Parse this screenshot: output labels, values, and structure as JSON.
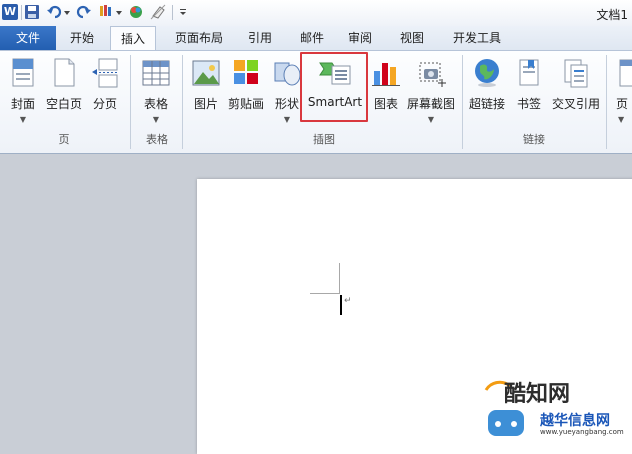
{
  "window": {
    "title": "文档1"
  },
  "qat": {
    "word_logo": "W",
    "icons": [
      "save-icon",
      "undo-icon",
      "redo-icon",
      "format-painter-icon",
      "color-icon",
      "eraser-icon",
      "customize-arrow-icon"
    ]
  },
  "tabs": [
    "文件",
    "开始",
    "插入",
    "页面布局",
    "引用",
    "邮件",
    "审阅",
    "视图",
    "开发工具"
  ],
  "active_tab": "插入",
  "ribbon": {
    "groups": {
      "page": "页",
      "table": "表格",
      "illustrations": "插图",
      "links": "链接"
    },
    "buttons": {
      "cover": "封面",
      "blank_page": "空白页",
      "page_break": "分页",
      "table": "表格",
      "picture": "图片",
      "clip_art": "剪贴画",
      "shapes": "形状",
      "smartart": "SmartArt",
      "chart": "图表",
      "screenshot": "屏幕截图",
      "hyperlink": "超链接",
      "bookmark": "书签",
      "cross_reference": "交叉引用",
      "page_partial": "页"
    }
  },
  "watermark": {
    "line1": "酷知网",
    "line2": "越华信息网",
    "line3": "www.yueyangbang.com"
  },
  "colors": {
    "file_tab": "#2a6bbf",
    "highlight_box": "#d9383e",
    "ribbon_bg": "#f3f6fb",
    "workspace_bg": "#c9ced6"
  }
}
